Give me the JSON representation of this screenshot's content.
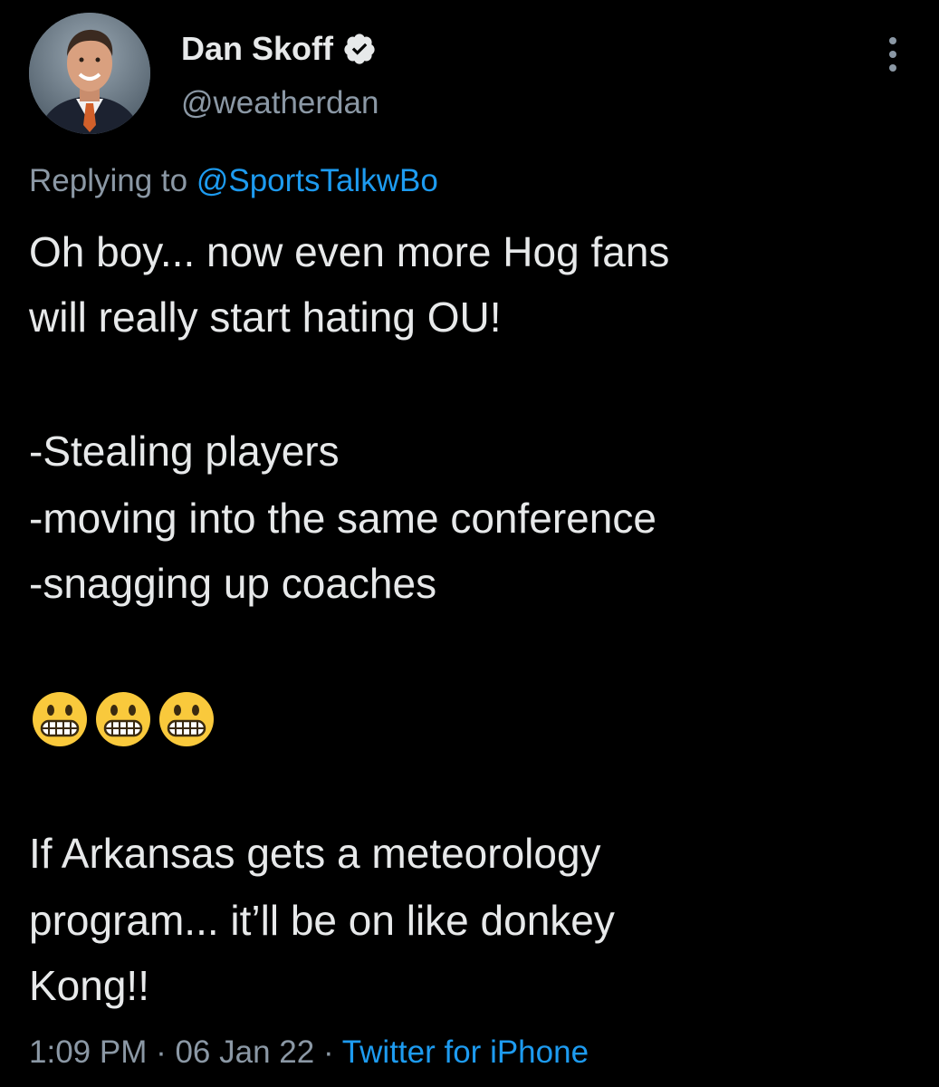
{
  "author": {
    "name": "Dan Skoff",
    "handle": "@weatherdan",
    "verified": true,
    "avatar_icon": "profile-photo"
  },
  "reply": {
    "prefix": "Replying to ",
    "mention": "@SportsTalkwBo"
  },
  "body": {
    "line1": "Oh boy...  now even more Hog fans",
    "line2": "will really start hating OU!",
    "line3": "-Stealing players",
    "line4": "-moving into the same conference",
    "line5": "-snagging up coaches",
    "emoji_icon": "grimacing-face-emoji",
    "emoji_count": 3,
    "line6": "If Arkansas gets a meteorology",
    "line7": "program... it’ll be on like donkey",
    "line8": "Kong!!"
  },
  "meta": {
    "time": "1:09 PM",
    "separator": " · ",
    "date": "06 Jan 22",
    "source": "Twitter for iPhone"
  },
  "colors": {
    "background": "#000000",
    "text": "#e7e9ea",
    "secondary": "#8b98a5",
    "link": "#1d9bf0"
  }
}
